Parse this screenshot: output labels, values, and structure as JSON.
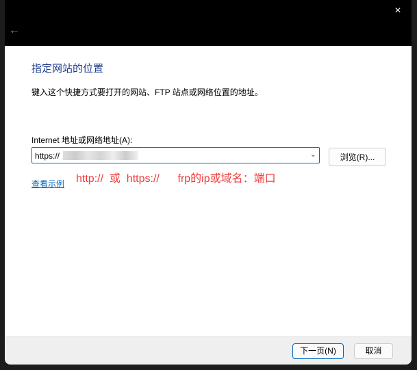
{
  "dialog": {
    "close_icon": "×",
    "back_icon": "←",
    "title": "指定网站的位置",
    "description": "键入这个快捷方式要打开的网站、FTP 站点或网络位置的地址。",
    "address_label": "Internet 地址或网络地址(A):",
    "address_value": "https://",
    "browse_label": "浏览(R)...",
    "example_link": "查看示例",
    "annotation": "http://  或  https://      frp的ip或域名：端口",
    "next_label": "下一页(N)",
    "cancel_label": "取消"
  }
}
